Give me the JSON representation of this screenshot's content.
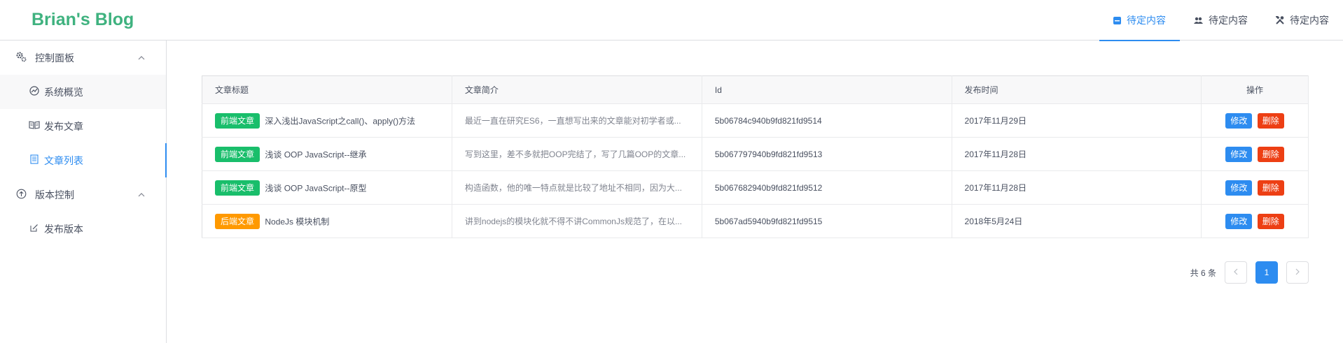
{
  "header": {
    "logo": "Brian's Blog",
    "nav": [
      {
        "label": "待定内容",
        "icon": "square-icon",
        "active": true
      },
      {
        "label": "待定内容",
        "icon": "people-icon",
        "active": false
      },
      {
        "label": "待定内容",
        "icon": "tools-icon",
        "active": false
      }
    ]
  },
  "sidebar": {
    "groups": [
      {
        "label": "控制面板",
        "icon": "gears-icon",
        "items": [
          {
            "label": "系统概览",
            "icon": "chart-icon"
          },
          {
            "label": "发布文章",
            "icon": "book-icon"
          },
          {
            "label": "文章列表",
            "icon": "document-icon",
            "active": true
          }
        ]
      },
      {
        "label": "版本控制",
        "icon": "upload-circle-icon",
        "items": [
          {
            "label": "发布版本",
            "icon": "edit-icon"
          }
        ]
      }
    ]
  },
  "table": {
    "columns": [
      "文章标题",
      "文章简介",
      "Id",
      "发布时间",
      "操作"
    ],
    "rows": [
      {
        "tag": "前端文章",
        "tag_type": "front",
        "title": "深入浅出JavaScript之call()、apply()方法",
        "intro": "最近一直在研究ES6，一直想写出来的文章能对初学者或...",
        "id": "5b06784c940b9fd821fd9514",
        "date": "2017年11月29日"
      },
      {
        "tag": "前端文章",
        "tag_type": "front",
        "title": "浅谈 OOP JavaScript--继承",
        "intro": "写到这里，差不多就把OOP完结了，写了几篇OOP的文章...",
        "id": "5b067797940b9fd821fd9513",
        "date": "2017年11月28日"
      },
      {
        "tag": "前端文章",
        "tag_type": "front",
        "title": "浅谈 OOP JavaScript--原型",
        "intro": "构造函数，他的唯一特点就是比较了地址不相同，因为大...",
        "id": "5b067682940b9fd821fd9512",
        "date": "2017年11月28日"
      },
      {
        "tag": "后端文章",
        "tag_type": "back",
        "title": "NodeJs 模块机制",
        "intro": "讲到nodejs的模块化就不得不讲CommonJs规范了，在以...",
        "id": "5b067ad5940b9fd821fd9515",
        "date": "2018年5月24日"
      }
    ],
    "edit_label": "修改",
    "delete_label": "删除"
  },
  "pagination": {
    "total_text": "共 6 条",
    "current_page": "1"
  },
  "colors": {
    "accent": "#2d8cf0",
    "brand": "#3fb27f",
    "front_tag": "#19be6b",
    "back_tag": "#ff9900",
    "delete": "#ed3f14"
  }
}
